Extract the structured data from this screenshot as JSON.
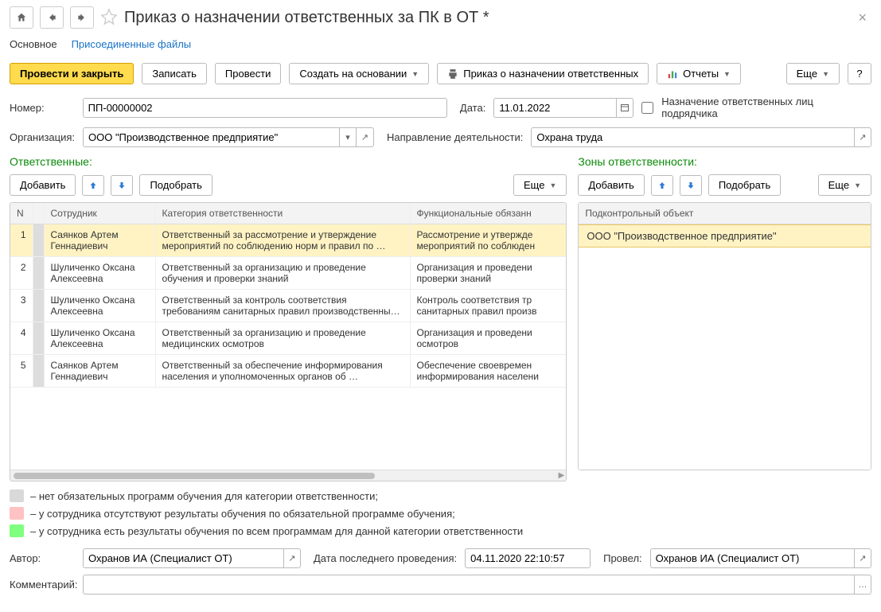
{
  "header": {
    "title": "Приказ о назначении ответственных за ПК в ОТ *"
  },
  "tabs": {
    "main": "Основное",
    "attachments": "Присоединенные файлы"
  },
  "toolbar": {
    "post_close": "Провести и закрыть",
    "save": "Записать",
    "post": "Провести",
    "create_based": "Создать на основании",
    "print_order": "Приказ о назначении ответственных",
    "reports": "Отчеты",
    "more": "Еще",
    "help": "?"
  },
  "form": {
    "number_label": "Номер:",
    "number_value": "ПП-00000002",
    "date_label": "Дата:",
    "date_value": "11.01.2022",
    "contractor_label": "Назначение ответственных лиц подрядчика",
    "org_label": "Организация:",
    "org_value": "ООО \"Производственное предприятие\"",
    "direction_label": "Направление деятельности:",
    "direction_value": "Охрана труда"
  },
  "responsible": {
    "title": "Ответственные:",
    "add": "Добавить",
    "pick": "Подобрать",
    "more": "Еще",
    "cols": {
      "n": "N",
      "employee": "Сотрудник",
      "category": "Категория ответственности",
      "duties": "Функциональные обязанн"
    },
    "rows": [
      {
        "n": "1",
        "employee": "Саянков Артем Геннадиевич",
        "category": "Ответственный за рассмотрение и утверждение мероприятий по соблюдению норм и правил по …",
        "duties": "Рассмотрение и утвержде мероприятий по соблюден"
      },
      {
        "n": "2",
        "employee": "Шуличенко Оксана Алексеевна",
        "category": "Ответственный за организацию и проведение обучения и проверки знаний",
        "duties": "Организация и проведени проверки знаний"
      },
      {
        "n": "3",
        "employee": "Шуличенко Оксана Алексеевна",
        "category": "Ответственный за контроль соответствия требованиям санитарных правил производственны…",
        "duties": "Контроль соответствия тр санитарных правил произв"
      },
      {
        "n": "4",
        "employee": "Шуличенко Оксана Алексеевна",
        "category": "Ответственный за организацию и проведение медицинских осмотров",
        "duties": "Организация и проведени осмотров"
      },
      {
        "n": "5",
        "employee": "Саянков Артем Геннадиевич",
        "category": "Ответственный за обеспечение информирования населения и уполномоченных органов об …",
        "duties": "Обеспечение своевремен информирования населени"
      }
    ]
  },
  "zones": {
    "title": "Зоны ответственности:",
    "add": "Добавить",
    "pick": "Подобрать",
    "more": "Еще",
    "col": "Подконтрольный объект",
    "rows": [
      "ООО \"Производственное предприятие\""
    ]
  },
  "legend": {
    "gray": "– нет обязательных программ обучения для категории ответственности;",
    "pink": "– у сотрудника отсутствуют результаты обучения по обязательной программе обучения;",
    "green": "– у сотрудника есть результаты обучения по всем программам для данной категории ответственности"
  },
  "footer": {
    "author_label": "Автор:",
    "author_value": "Охранов ИА (Специалист ОТ)",
    "lastpost_label": "Дата последнего проведения:",
    "lastpost_value": "04.11.2020 22:10:57",
    "poster_label": "Провел:",
    "poster_value": "Охранов ИА (Специалист ОТ)",
    "comment_label": "Комментарий:"
  }
}
